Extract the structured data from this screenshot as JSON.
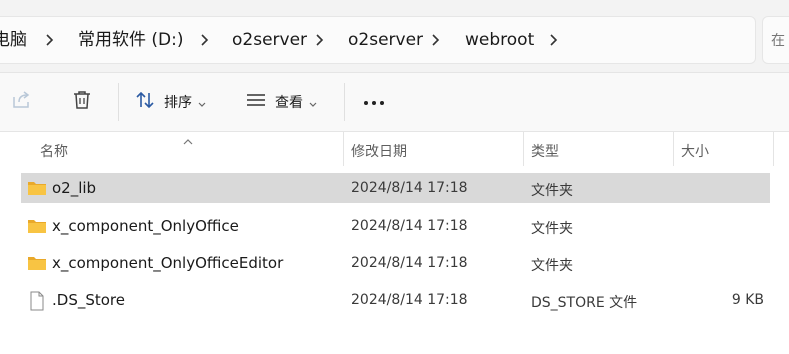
{
  "address": {
    "crumbs": [
      "电脑",
      "常用软件 (D:)",
      "o2server",
      "o2server",
      "webroot"
    ],
    "search_hint": "在"
  },
  "toolbar": {
    "sort_label": "排序",
    "view_label": "查看",
    "more_label": "•••"
  },
  "columns": {
    "name": "名称",
    "date": "修改日期",
    "type": "类型",
    "size": "大小"
  },
  "files": [
    {
      "name": "o2_lib",
      "date": "2024/8/14 17:18",
      "type": "文件夹",
      "size": "",
      "icon": "folder-icon",
      "selected": true
    },
    {
      "name": "x_component_OnlyOffice",
      "date": "2024/8/14 17:18",
      "type": "文件夹",
      "size": "",
      "icon": "folder-icon",
      "selected": false
    },
    {
      "name": "x_component_OnlyOfficeEditor",
      "date": "2024/8/14 17:18",
      "type": "文件夹",
      "size": "",
      "icon": "folder-icon",
      "selected": false
    },
    {
      "name": ".DS_Store",
      "date": "2024/8/14 17:18",
      "type": "DS_STORE 文件",
      "size": "9 KB",
      "icon": "file-icon",
      "selected": false
    }
  ],
  "colors": {
    "folder": "#f8c443",
    "selection": "#d9d9d9",
    "toolbar_bg": "#f9f9f9"
  }
}
